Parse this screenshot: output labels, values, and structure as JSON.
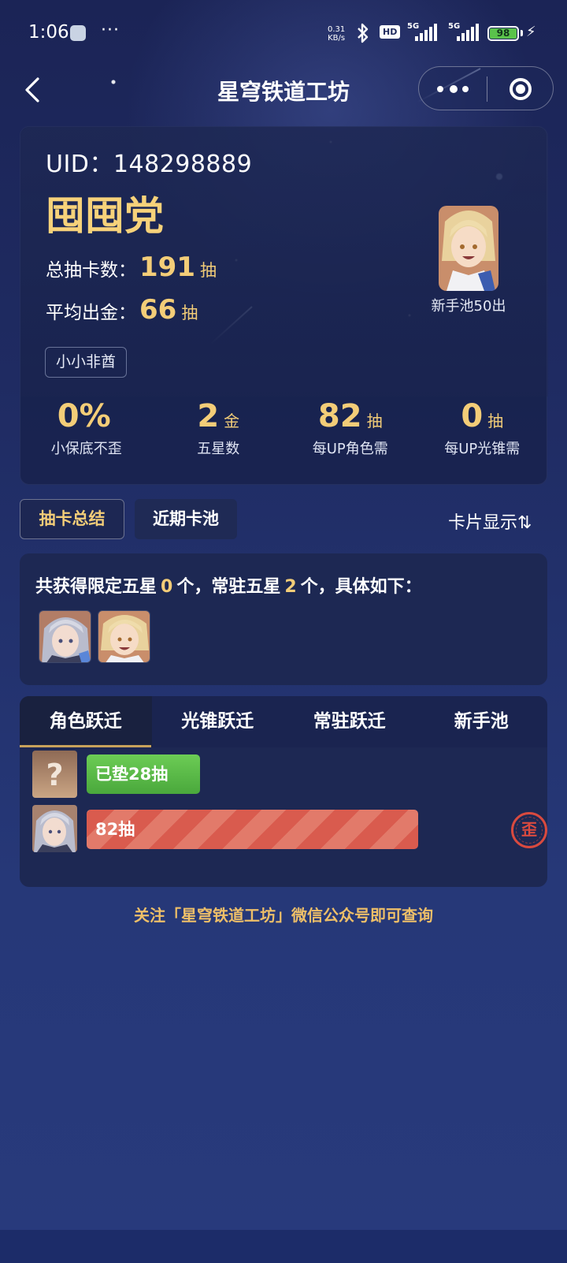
{
  "status_bar": {
    "time": "1:06",
    "more": "···",
    "net_speed_value": "0.31",
    "net_speed_unit": "KB/s",
    "hd": "HD",
    "network_1": "5G",
    "network_2": "5G",
    "battery": "98",
    "battery_color": "#5ac24b"
  },
  "header": {
    "title": "星穹铁道工坊"
  },
  "profile": {
    "uid_label": "UID：",
    "uid": "148298889",
    "nickname": "囤囤党",
    "total_label": "总抽卡数：",
    "total_value": "191",
    "total_unit": "抽",
    "avg_label": "平均出金：",
    "avg_value": "66",
    "avg_unit": "抽",
    "tag": "小小非酋",
    "newbie_caption": "新手池50出"
  },
  "metrics": [
    {
      "value": "0%",
      "unit": "",
      "label": "小保底不歪"
    },
    {
      "value": "2",
      "unit": "金",
      "label": "五星数"
    },
    {
      "value": "82",
      "unit": "抽",
      "label": "每UP角色需"
    },
    {
      "value": "0",
      "unit": "抽",
      "label": "每UP光锥需"
    }
  ],
  "view_tabs": {
    "summary": "抽卡总结",
    "recent": "近期卡池",
    "display_toggle": "卡片显示⇅"
  },
  "five_star_summary": {
    "prefix": "共获得限定五星",
    "limited_count": "0",
    "middle": "个，常驻五星",
    "standard_count": "2",
    "suffix": "个，具体如下：",
    "avatars": [
      "bronya-avatar",
      "aventurine-avatar"
    ]
  },
  "warp_tabs": [
    {
      "label": "角色跃迁",
      "active": true
    },
    {
      "label": "光锥跃迁",
      "active": false
    },
    {
      "label": "常驻跃迁",
      "active": false
    },
    {
      "label": "新手池",
      "active": false
    }
  ],
  "warp_bars": [
    {
      "label": "已垫28抽",
      "pulls": 28,
      "color": "#5ab848",
      "avatar": "unknown",
      "avatar_glyph": "?"
    },
    {
      "label": "82抽",
      "pulls": 82,
      "color": "#d95b4e",
      "avatar": "bronya-avatar",
      "badge": "歪"
    }
  ],
  "footer": {
    "note": "关注「星穹铁道工坊」微信公众号即可查询"
  },
  "colors": {
    "accent_gold": "#f3cd78",
    "background": "#1f2b62",
    "card": "#1d2853"
  }
}
